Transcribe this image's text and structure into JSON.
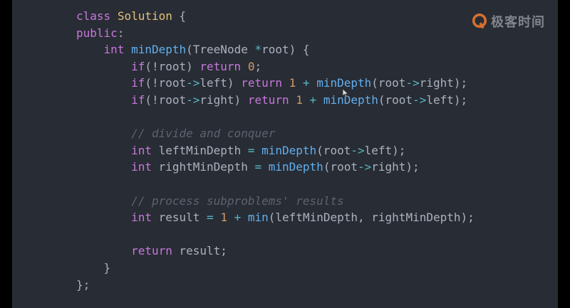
{
  "watermark": {
    "brand": "极客时间",
    "icon": "geektime-logo-icon"
  },
  "colors": {
    "background": "#282c34",
    "keyword": "#c678dd",
    "function": "#61afef",
    "class": "#e5c07b",
    "number": "#d19a66",
    "operator": "#56b6c2",
    "comment": "#5c6370",
    "plain": "#abb2bf",
    "watermark": "#8a8f98"
  },
  "code": {
    "language": "cpp",
    "lines": [
      [
        [
          "kw",
          "class"
        ],
        [
          "pl",
          " "
        ],
        [
          "cls",
          "Solution"
        ],
        [
          "pl",
          " {"
        ]
      ],
      [
        [
          "kw",
          "public"
        ],
        [
          "pl",
          ":"
        ]
      ],
      [
        [
          "pl",
          "    "
        ],
        [
          "kw",
          "int"
        ],
        [
          "pl",
          " "
        ],
        [
          "fn",
          "minDepth"
        ],
        [
          "pl",
          "(TreeNode "
        ],
        [
          "op",
          "*"
        ],
        [
          "pl",
          "root) {"
        ]
      ],
      [
        [
          "pl",
          "        "
        ],
        [
          "kw",
          "if"
        ],
        [
          "pl",
          "(!root) "
        ],
        [
          "kw",
          "return"
        ],
        [
          "pl",
          " "
        ],
        [
          "num",
          "0"
        ],
        [
          "pl",
          ";"
        ]
      ],
      [
        [
          "pl",
          "        "
        ],
        [
          "kw",
          "if"
        ],
        [
          "pl",
          "(!root"
        ],
        [
          "op",
          "->"
        ],
        [
          "pl",
          "left) "
        ],
        [
          "kw",
          "return"
        ],
        [
          "pl",
          " "
        ],
        [
          "num",
          "1"
        ],
        [
          "pl",
          " "
        ],
        [
          "op",
          "+"
        ],
        [
          "pl",
          " "
        ],
        [
          "fn",
          "minDepth"
        ],
        [
          "pl",
          "(root"
        ],
        [
          "op",
          "->"
        ],
        [
          "pl",
          "right);"
        ]
      ],
      [
        [
          "pl",
          "        "
        ],
        [
          "kw",
          "if"
        ],
        [
          "pl",
          "(!root"
        ],
        [
          "op",
          "->"
        ],
        [
          "pl",
          "right) "
        ],
        [
          "kw",
          "return"
        ],
        [
          "pl",
          " "
        ],
        [
          "num",
          "1"
        ],
        [
          "pl",
          " "
        ],
        [
          "op",
          "+"
        ],
        [
          "pl",
          " "
        ],
        [
          "fn",
          "minDepth"
        ],
        [
          "pl",
          "(root"
        ],
        [
          "op",
          "->"
        ],
        [
          "pl",
          "left);"
        ]
      ],
      [],
      [
        [
          "pl",
          "        "
        ],
        [
          "cm",
          "// divide and conquer"
        ]
      ],
      [
        [
          "pl",
          "        "
        ],
        [
          "kw",
          "int"
        ],
        [
          "pl",
          " leftMinDepth "
        ],
        [
          "op",
          "="
        ],
        [
          "pl",
          " "
        ],
        [
          "fn",
          "minDepth"
        ],
        [
          "pl",
          "(root"
        ],
        [
          "op",
          "->"
        ],
        [
          "pl",
          "left);"
        ]
      ],
      [
        [
          "pl",
          "        "
        ],
        [
          "kw",
          "int"
        ],
        [
          "pl",
          " rightMinDepth "
        ],
        [
          "op",
          "="
        ],
        [
          "pl",
          " "
        ],
        [
          "fn",
          "minDepth"
        ],
        [
          "pl",
          "(root"
        ],
        [
          "op",
          "->"
        ],
        [
          "pl",
          "right);"
        ]
      ],
      [],
      [
        [
          "pl",
          "        "
        ],
        [
          "cm",
          "// process subproblems' results"
        ]
      ],
      [
        [
          "pl",
          "        "
        ],
        [
          "kw",
          "int"
        ],
        [
          "pl",
          " result "
        ],
        [
          "op",
          "="
        ],
        [
          "pl",
          " "
        ],
        [
          "num",
          "1"
        ],
        [
          "pl",
          " "
        ],
        [
          "op",
          "+"
        ],
        [
          "pl",
          " "
        ],
        [
          "fn",
          "min"
        ],
        [
          "pl",
          "(leftMinDepth, rightMinDepth);"
        ]
      ],
      [],
      [
        [
          "pl",
          "        "
        ],
        [
          "kw",
          "return"
        ],
        [
          "pl",
          " result;"
        ]
      ],
      [
        [
          "pl",
          "    }"
        ]
      ],
      [
        [
          "pl",
          "};"
        ]
      ]
    ]
  }
}
